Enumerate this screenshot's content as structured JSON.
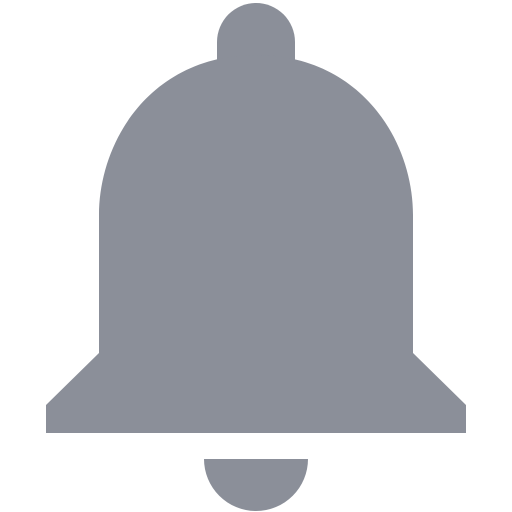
{
  "icon": {
    "name": "bell-icon",
    "color": "#8b8f99",
    "background": "#ffffff"
  }
}
